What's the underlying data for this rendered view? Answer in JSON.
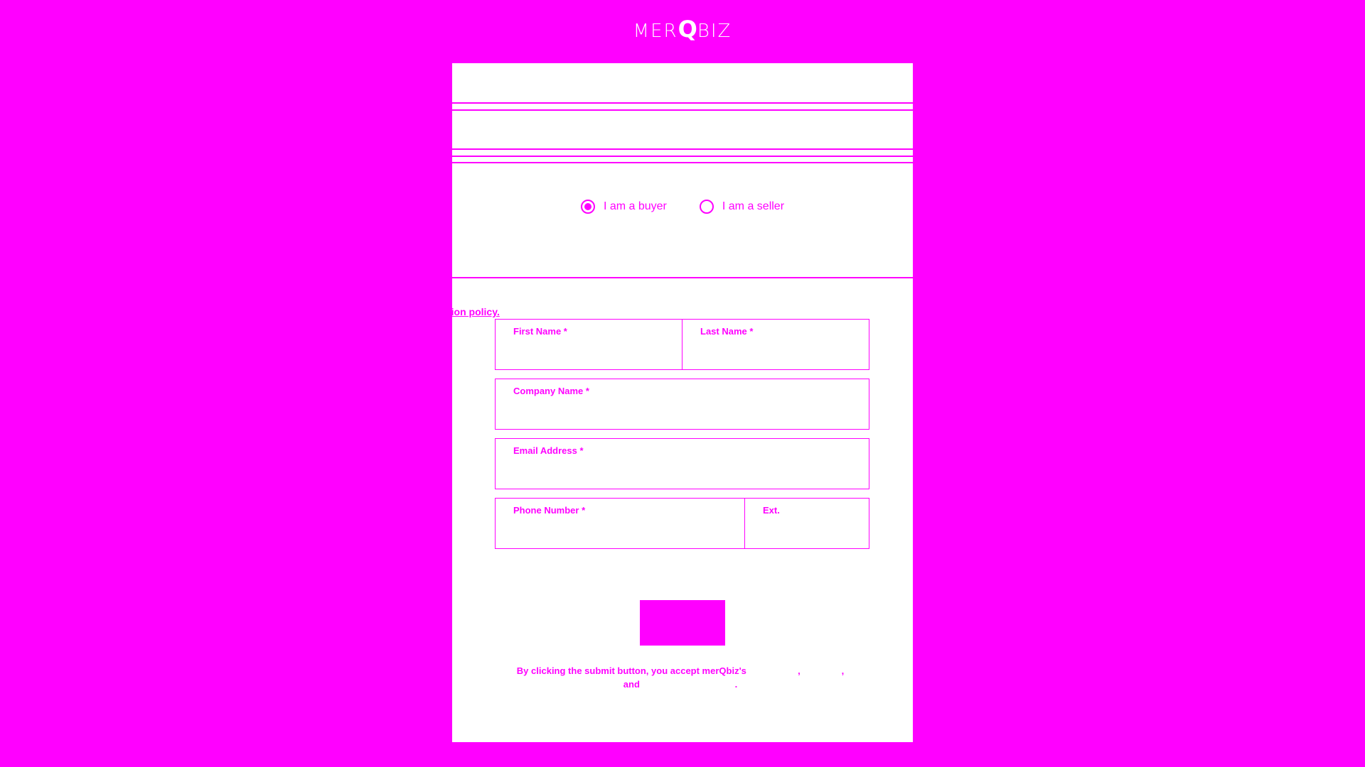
{
  "brand": {
    "logo_prefix": "MER",
    "logo_q": "Q",
    "logo_suffix": "BIZ"
  },
  "role": {
    "options": [
      {
        "label": "I am a buyer",
        "selected": true
      },
      {
        "label": "I am a seller",
        "selected": false
      }
    ]
  },
  "policy_link": "olution policy.",
  "form": {
    "first_name_label": "First Name *",
    "last_name_label": "Last Name *",
    "company_label": "Company Name *",
    "email_label": "Email Address *",
    "phone_label": "Phone Number *",
    "ext_label": "Ext."
  },
  "terms": {
    "line1": "By clicking the submit button, you accept merQbiz's",
    "comma": ",",
    "and": "and",
    "period": "."
  },
  "colors": {
    "accent": "#ff00ff",
    "card": "#ffffff"
  }
}
